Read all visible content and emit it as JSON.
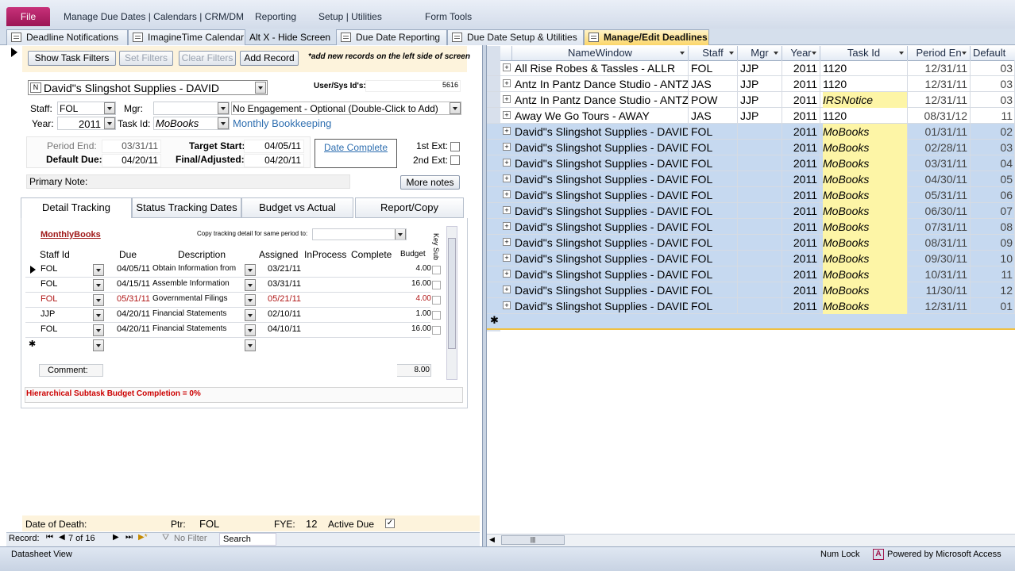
{
  "ribbon": {
    "file": "File",
    "menus": [
      "Manage Due Dates | Calendars | CRM/DM",
      "Reporting",
      "Setup | Utilities",
      "Form Tools"
    ]
  },
  "doctabs": [
    "Deadline Notifications",
    "ImagineTime Calendar",
    "Alt X - Hide Screen",
    "Due Date Reporting",
    "Due Date Setup & Utilities",
    "Manage/Edit Deadlines"
  ],
  "form": {
    "buttons": {
      "show": "Show Task Filters",
      "set": "Set Filters",
      "clear": "Clear Filters",
      "add": "Add Record",
      "more": "More notes"
    },
    "note": "*add new records on the left side of screen",
    "n": "N",
    "client": "David\"s Slingshot Supplies - DAVID",
    "usersys_label": "User/Sys Id's:",
    "usersys_val": "5616",
    "staff_label": "Staff:",
    "staff": "FOL",
    "mgr_label": "Mgr:",
    "engagement": "No Engagement - Optional  (Double-Click to Add)",
    "year_label": "Year:",
    "year": "2011",
    "taskid_label": "Task Id:",
    "taskid": "MoBooks",
    "task_desc": "Monthly Bookkeeping",
    "period_end_label": "Period End:",
    "period_end": "03/31/11",
    "target_start_label": "Target Start:",
    "target_start": "04/05/11",
    "default_due_label": "Default Due:",
    "default_due": "04/20/11",
    "final_label": "Final/Adjusted:",
    "final": "04/20/11",
    "date_complete": "Date Complete",
    "ext1": "1st Ext:",
    "ext2": "2nd Ext:",
    "primary_note": "Primary Note:"
  },
  "subtabs": [
    "Detail Tracking",
    "Status Tracking Dates",
    "Budget vs Actual",
    "Report/Copy"
  ],
  "detail": {
    "title": "MonthlyBooks",
    "copy_label": "Copy tracking detail for same period to:",
    "keysub": "Key Sub",
    "headers": [
      "Staff Id",
      "Due",
      "Description",
      "Assigned",
      "InProcess",
      "Complete",
      "Budget"
    ],
    "rows": [
      [
        "FOL",
        "04/05/11",
        "Obtain Information from",
        "03/21/11",
        "",
        "",
        "4.00"
      ],
      [
        "FOL",
        "04/15/11",
        "Assemble Information",
        "03/31/11",
        "",
        "",
        "16.00"
      ],
      [
        "FOL",
        "05/31/11",
        "Governmental Filings",
        "05/21/11",
        "",
        "",
        "4.00"
      ],
      [
        "JJP",
        "04/20/11",
        "Financial Statements",
        "02/10/11",
        "",
        "",
        "1.00"
      ],
      [
        "FOL",
        "04/20/11",
        "Financial Statements",
        "04/10/11",
        "",
        "",
        "16.00"
      ]
    ],
    "comment_label": "Comment:",
    "comment_total": "8.00",
    "hier": "Hierarchical Subtask Budget Completion = 0%"
  },
  "footer": {
    "dod": "Date of Death:",
    "ptr_label": "Ptr:",
    "ptr": "FOL",
    "fye_label": "FYE:",
    "fye": "12",
    "active": "Active Due"
  },
  "nav": {
    "record": "Record:",
    "pos": "7 of 16",
    "nofilter": "No Filter",
    "search": "Search"
  },
  "datasheet": {
    "headers": [
      "NameWindow",
      "Staff",
      "Mgr",
      "Year",
      "Task Id",
      "Period En",
      "Default"
    ],
    "rows": [
      [
        "All Rise Robes & Tassles - ALLR",
        "FOL",
        "JJP",
        "2011",
        "1120",
        "12/31/11",
        "03"
      ],
      [
        "Antz In Pantz Dance Studio - ANTZ",
        "JAS",
        "JJP",
        "2011",
        "1120",
        "12/31/11",
        "03"
      ],
      [
        "Antz In Pantz Dance Studio - ANTZ",
        "POW",
        "JJP",
        "2011",
        "IRSNotice",
        "12/31/11",
        "03"
      ],
      [
        "Away We Go Tours - AWAY",
        "JAS",
        "JJP",
        "2011",
        "1120",
        "08/31/12",
        "11"
      ],
      [
        "David\"s Slingshot Supplies - DAVID",
        "FOL",
        "",
        "2011",
        "MoBooks",
        "01/31/11",
        "02"
      ],
      [
        "David\"s Slingshot Supplies - DAVID",
        "FOL",
        "",
        "2011",
        "MoBooks",
        "02/28/11",
        "03"
      ],
      [
        "David\"s Slingshot Supplies - DAVID",
        "FOL",
        "",
        "2011",
        "MoBooks",
        "03/31/11",
        "04"
      ],
      [
        "David\"s Slingshot Supplies - DAVID",
        "FOL",
        "",
        "2011",
        "MoBooks",
        "04/30/11",
        "05"
      ],
      [
        "David\"s Slingshot Supplies - DAVID",
        "FOL",
        "",
        "2011",
        "MoBooks",
        "05/31/11",
        "06"
      ],
      [
        "David\"s Slingshot Supplies - DAVID",
        "FOL",
        "",
        "2011",
        "MoBooks",
        "06/30/11",
        "07"
      ],
      [
        "David\"s Slingshot Supplies - DAVID",
        "FOL",
        "",
        "2011",
        "MoBooks",
        "07/31/11",
        "08"
      ],
      [
        "David\"s Slingshot Supplies - DAVID",
        "FOL",
        "",
        "2011",
        "MoBooks",
        "08/31/11",
        "09"
      ],
      [
        "David\"s Slingshot Supplies - DAVID",
        "FOL",
        "",
        "2011",
        "MoBooks",
        "09/30/11",
        "10"
      ],
      [
        "David\"s Slingshot Supplies - DAVID",
        "FOL",
        "",
        "2011",
        "MoBooks",
        "10/31/11",
        "11"
      ],
      [
        "David\"s Slingshot Supplies - DAVID",
        "FOL",
        "",
        "2011",
        "MoBooks",
        "11/30/11",
        "12"
      ],
      [
        "David\"s Slingshot Supplies - DAVID",
        "FOL",
        "",
        "2011",
        "MoBooks",
        "12/31/11",
        "01"
      ]
    ]
  },
  "status": {
    "view": "Datasheet View",
    "numlock": "Num Lock",
    "powered": "Powered by Microsoft Access"
  }
}
